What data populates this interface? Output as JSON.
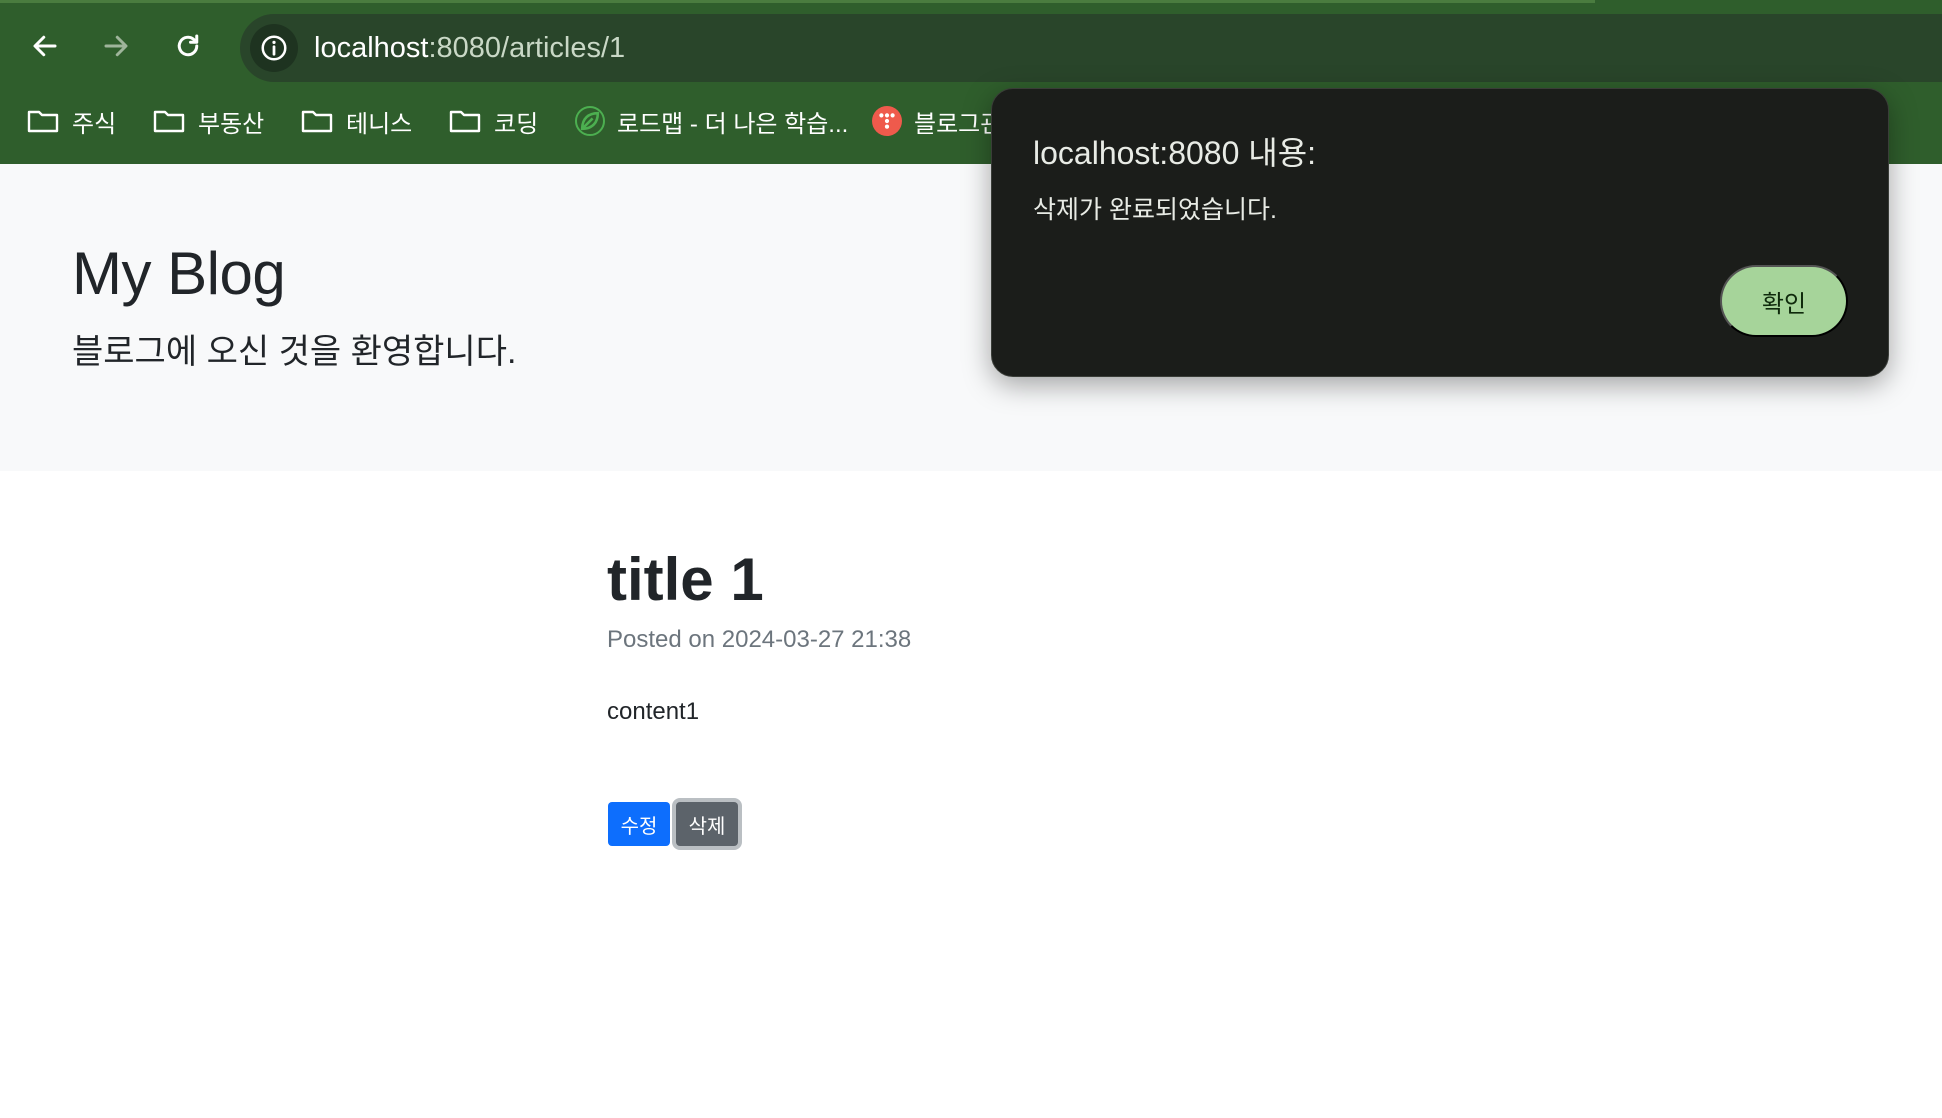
{
  "browser": {
    "url_host": "localhost",
    "url_path": ":8080/articles/1",
    "bookmarks": [
      {
        "label": "주식",
        "icon": "folder-icon"
      },
      {
        "label": "부동산",
        "icon": "folder-icon"
      },
      {
        "label": "테니스",
        "icon": "folder-icon"
      },
      {
        "label": "코딩",
        "icon": "folder-icon"
      },
      {
        "label": "로드맵 - 더 나은 학습...",
        "icon": "roadmap-leaf-icon"
      },
      {
        "label": "블로그관",
        "icon": "blog-favicon-icon"
      }
    ],
    "colors": {
      "chrome": "#2f5e2c",
      "omnibox": "#29452a"
    }
  },
  "hero": {
    "title": "My Blog",
    "subtitle": "블로그에 오신 것을 환영합니다."
  },
  "article": {
    "title": "title 1",
    "posted": "Posted on 2024-03-27 21:38",
    "content": "content1",
    "edit_label": "수정",
    "delete_label": "삭제"
  },
  "dialog": {
    "title": "localhost:8080 내용:",
    "message": "삭제가 완료되었습니다.",
    "ok_label": "확인",
    "colors": {
      "background": "#1b1d1a",
      "button": "#a6d49a"
    }
  }
}
